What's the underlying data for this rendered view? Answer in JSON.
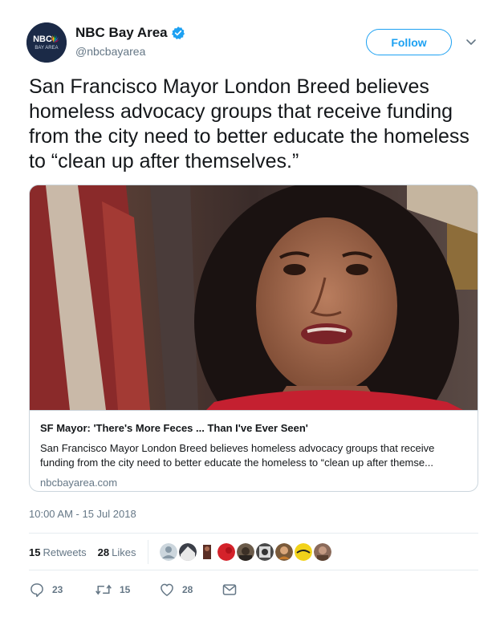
{
  "account": {
    "display_name": "NBC Bay Area",
    "handle": "@nbcbayarea",
    "logo_text_top": "NBC",
    "logo_text_bottom": "BAY AREA",
    "verified": true
  },
  "follow_button": {
    "label": "Follow"
  },
  "tweet": {
    "text": "San Francisco Mayor London Breed believes homeless advocacy groups that receive funding from the city need to better educate the homeless to “clean up after themselves.”",
    "timestamp": "10:00 AM - 15 Jul 2018"
  },
  "card": {
    "title": "SF Mayor: 'There's More Feces ... Than I've Ever Seen'",
    "description": "San Francisco Mayor London Breed believes homeless advocacy groups that receive funding from the city need to better educate the homeless to “clean up after themse...",
    "domain": "nbcbayarea.com"
  },
  "stats": {
    "retweets_count": "15",
    "retweets_label": "Retweets",
    "likes_count": "28",
    "likes_label": "Likes"
  },
  "actions": {
    "reply_count": "23",
    "retweet_count": "15",
    "like_count": "28"
  },
  "colors": {
    "accent": "#1da1f2",
    "text": "#14171a",
    "muted": "#657786",
    "border": "#ccd6dd"
  },
  "icons": [
    "verified-badge-icon",
    "chevron-down-icon",
    "reply-icon",
    "retweet-icon",
    "heart-icon",
    "message-icon"
  ]
}
